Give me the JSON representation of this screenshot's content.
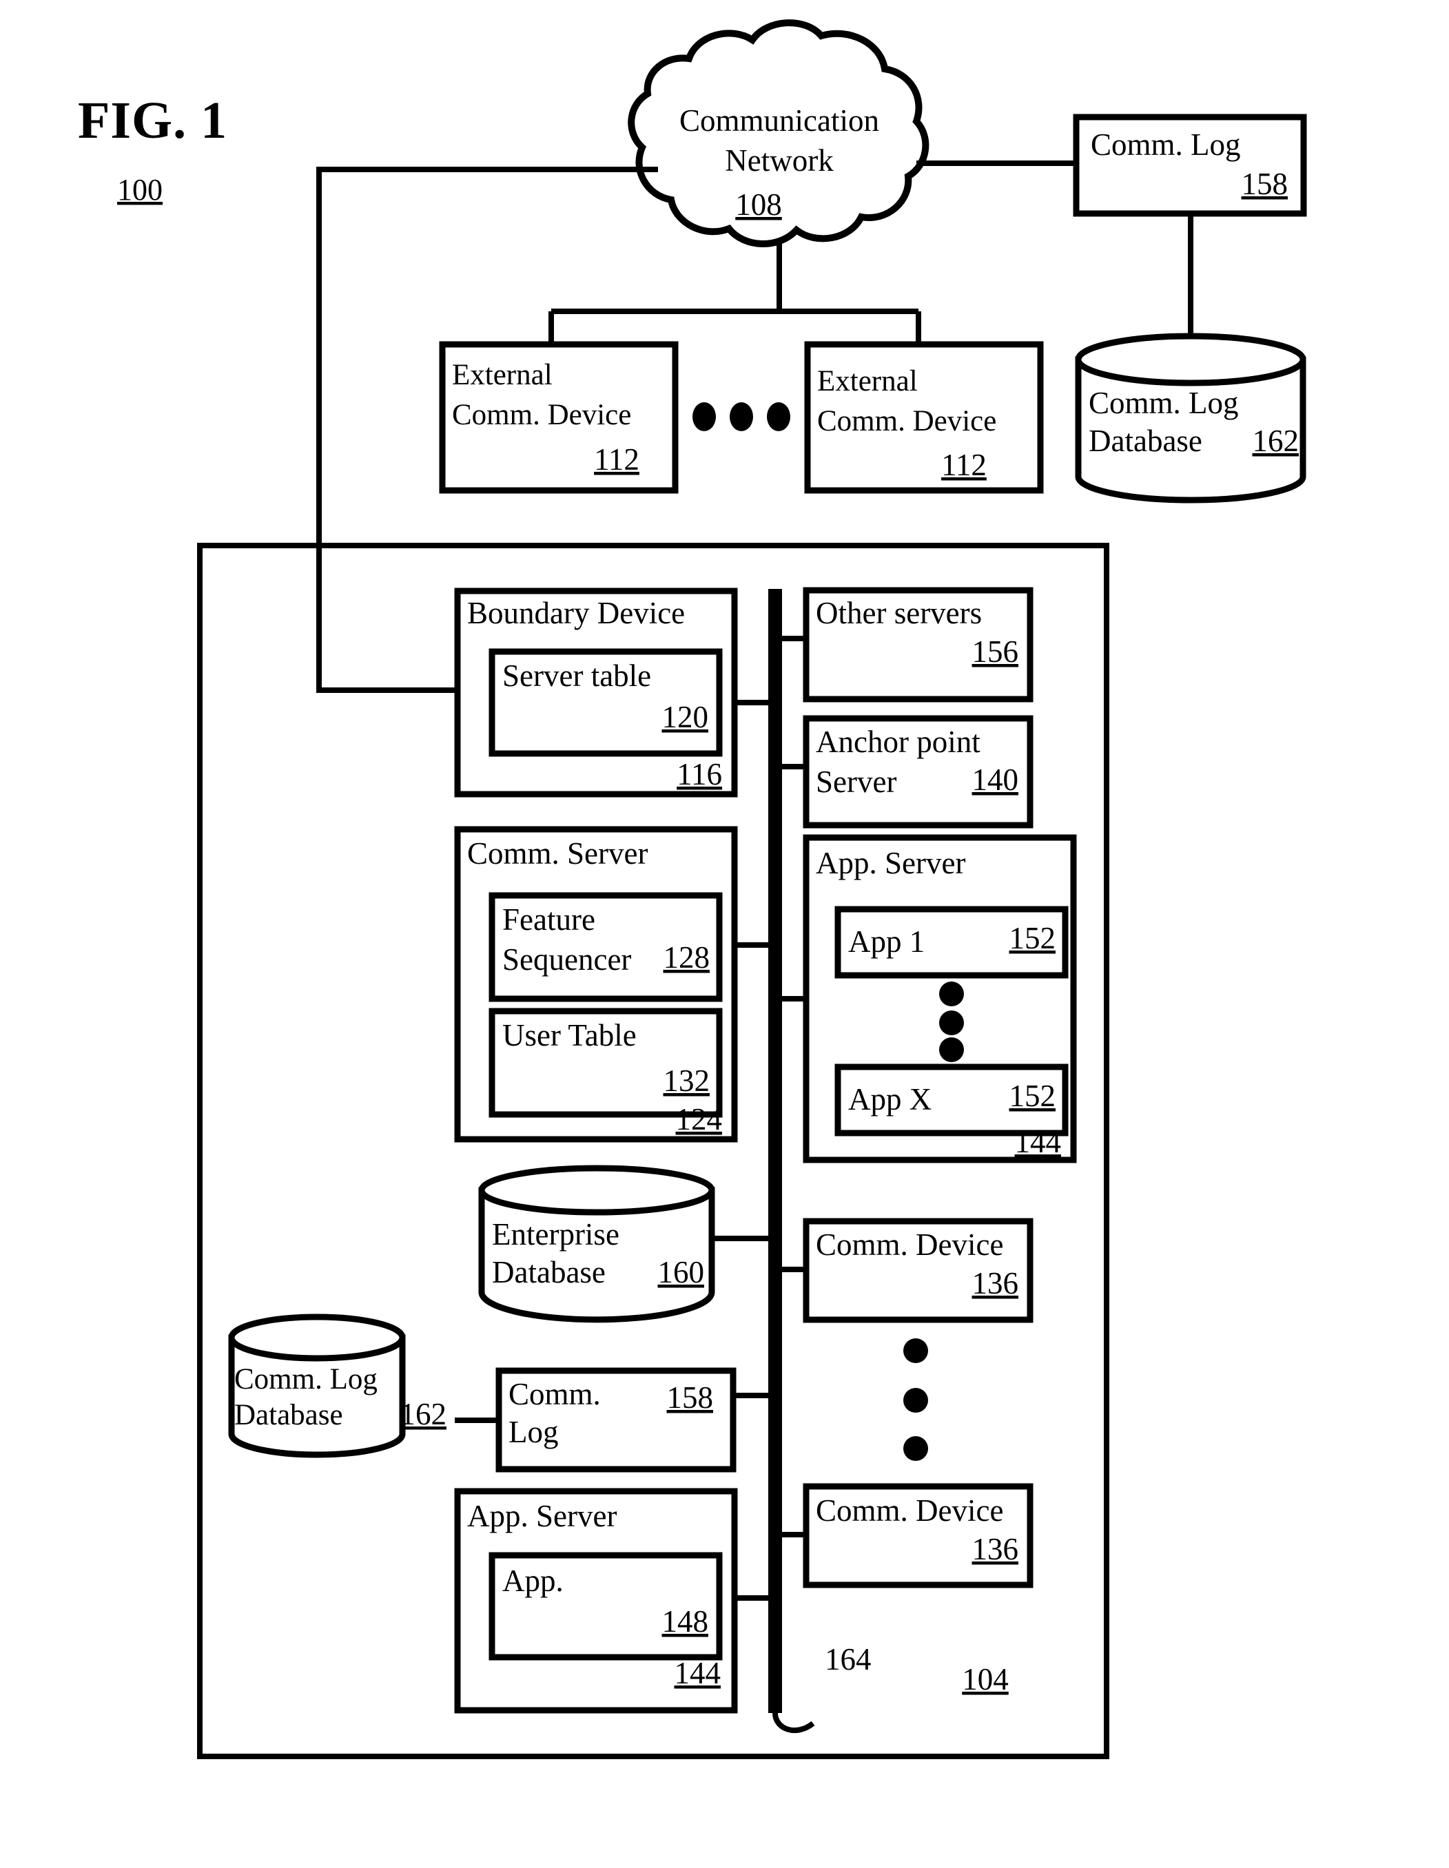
{
  "figure": {
    "title": "FIG. 1",
    "system_ref": "100"
  },
  "cloud": {
    "line1": "Communication",
    "line2": "Network",
    "ref": "108"
  },
  "top_right": {
    "comm_log": {
      "label": "Comm. Log",
      "ref": "158"
    },
    "comm_log_db": {
      "line1": "Comm. Log",
      "line2": "Database",
      "ref": "162"
    }
  },
  "external_devices": [
    {
      "line1": "External",
      "line2": "Comm. Device",
      "ref": "112"
    },
    {
      "line1": "External",
      "line2": "Comm. Device",
      "ref": "112"
    }
  ],
  "ellipsis_horizontal": "• • •",
  "enterprise": {
    "ref": "104",
    "bus_ref": "164",
    "left_column": {
      "boundary_device": {
        "label": "Boundary Device",
        "ref": "116",
        "inner": {
          "label": "Server table",
          "ref": "120"
        }
      },
      "comm_server": {
        "label": "Comm. Server",
        "ref": "124",
        "inner": [
          {
            "line1": "Feature",
            "line2": "Sequencer",
            "ref": "128"
          },
          {
            "line1": "User Table",
            "line2": "",
            "ref": "132"
          }
        ]
      },
      "enterprise_database": {
        "line1": "Enterprise",
        "line2": "Database",
        "ref": "160"
      },
      "comm_log_database": {
        "line1": "Comm. Log",
        "line2": "Database",
        "ref": "162"
      },
      "comm_log": {
        "line1": "Comm.",
        "line2": "Log",
        "ref": "158"
      },
      "app_server": {
        "label": "App. Server",
        "ref": "144",
        "inner": {
          "label": "App.",
          "ref": "148"
        }
      }
    },
    "right_column": {
      "other_servers": {
        "label": "Other servers",
        "ref": "156"
      },
      "anchor_point_server": {
        "line1": "Anchor point",
        "line2": "Server",
        "ref": "140"
      },
      "app_server": {
        "label": "App. Server",
        "ref": "144",
        "apps": [
          {
            "label": "App 1",
            "ref": "152"
          },
          {
            "label": "App X",
            "ref": "152"
          }
        ]
      },
      "comm_devices": [
        {
          "label": "Comm. Device",
          "ref": "136"
        },
        {
          "label": "Comm. Device",
          "ref": "136"
        }
      ]
    }
  },
  "colors": {
    "stroke": "#000000",
    "fill": "#ffffff"
  }
}
